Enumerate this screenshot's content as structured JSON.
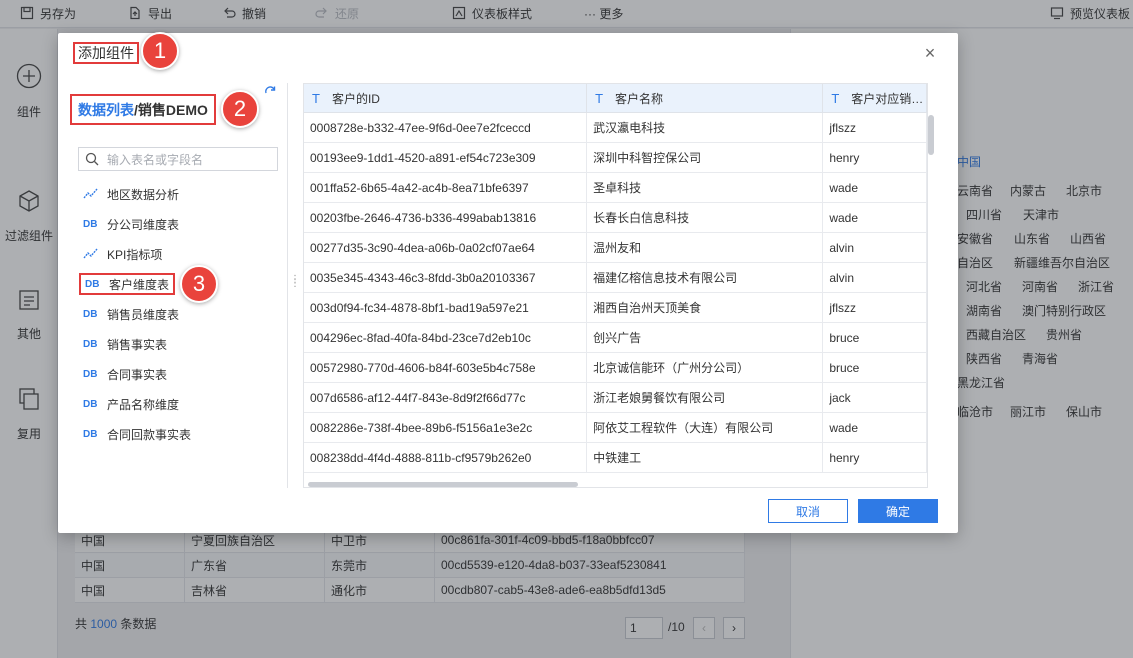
{
  "toolbar": {
    "save_as": "另存为",
    "export": "导出",
    "undo": "撤销",
    "redo": "还原",
    "dashboard_style": "仪表板样式",
    "more": "··· 更多",
    "preview": "预览仪表板"
  },
  "rail": {
    "components": "组件",
    "filter_components": "过滤组件",
    "others": "其他",
    "reuse": "复用"
  },
  "background": {
    "regions": {
      "china": "中国",
      "r1": [
        "云南省",
        "内蒙古",
        "北京市"
      ],
      "r2": [
        "四川省",
        "天津市"
      ],
      "r3": [
        "安徽省",
        "山东省",
        "山西省"
      ],
      "r4": [
        "自治区",
        "新疆维吾尔自治区"
      ],
      "r5": [
        "河北省",
        "河南省",
        "浙江省"
      ],
      "r6": [
        "湖南省",
        "澳门特别行政区"
      ],
      "r7": [
        "西藏自治区",
        "贵州省"
      ],
      "r8": [
        "陕西省",
        "青海省"
      ],
      "r9": [
        "黑龙江省"
      ],
      "r10": [
        "临沧市",
        "丽江市",
        "保山市"
      ]
    },
    "table_rows": [
      [
        "中国",
        "宁夏回族自治区",
        "中卫市",
        "00c861fa-301f-4c09-bbd5-f18a0bbfcc07"
      ],
      [
        "中国",
        "广东省",
        "东莞市",
        "00cd5539-e120-4da8-b037-33eaf5230841"
      ],
      [
        "中国",
        "吉林省",
        "通化市",
        "00cdb807-cab5-43e8-ade6-ea8b5dfd13d5"
      ]
    ],
    "footer_prefix": "共",
    "footer_count": "1000",
    "footer_suffix": "条数据",
    "page_current": "1",
    "page_total": "/10"
  },
  "dialog": {
    "title": "添加组件",
    "close": "×",
    "path_link": "数据列表",
    "path_current": "/销售DEMO",
    "search_placeholder": "输入表名或字段名",
    "tree": [
      {
        "icon": "kpi",
        "label": "地区数据分析"
      },
      {
        "icon": "db",
        "label": "分公司维度表"
      },
      {
        "icon": "kpi",
        "label": "KPI指标项"
      },
      {
        "icon": "db",
        "label": "客户维度表"
      },
      {
        "icon": "db",
        "label": "销售员维度表"
      },
      {
        "icon": "db",
        "label": "销售事实表"
      },
      {
        "icon": "db",
        "label": "合同事实表"
      },
      {
        "icon": "db",
        "label": "产品名称维度"
      },
      {
        "icon": "db",
        "label": "合同回款事实表"
      }
    ],
    "db_icon_text": "DB",
    "columns": [
      "客户的ID",
      "客户名称",
      "客户对应销…"
    ],
    "rows": [
      [
        "0008728e-b332-47ee-9f6d-0ee7e2fceccd",
        "武汉瀛电科技",
        "jflszz"
      ],
      [
        "00193ee9-1dd1-4520-a891-ef54c723e309",
        "深圳中科智控保公司",
        "henry"
      ],
      [
        "001ffa52-6b65-4a42-ac4b-8ea71bfe6397",
        "圣卓科技",
        "wade"
      ],
      [
        "00203fbe-2646-4736-b336-499abab13816",
        "长春长白信息科技",
        "wade"
      ],
      [
        "00277d35-3c90-4dea-a06b-0a02cf07ae64",
        "温州友和",
        "alvin"
      ],
      [
        "0035e345-4343-46c3-8fdd-3b0a20103367",
        "福建亿榕信息技术有限公司",
        "alvin"
      ],
      [
        "003d0f94-fc34-4878-8bf1-bad19a597e21",
        "湘西自治州天顶美食",
        "jflszz"
      ],
      [
        "004296ec-8fad-40fa-84bd-23ce7d2eb10c",
        "创兴广告",
        "bruce"
      ],
      [
        "00572980-770d-4606-b84f-603e5b4c758e",
        "北京诚信能环（广州分公司）",
        "bruce"
      ],
      [
        "007d6586-af12-44f7-843e-8d9f2f66d77c",
        "浙江老娘舅餐饮有限公司",
        "jack"
      ],
      [
        "0082286e-738f-4bee-89b6-f5156a1e3e2c",
        "阿依艾工程软件（大连）有限公司",
        "wade"
      ],
      [
        "008238dd-4f4d-4888-811b-cf9579b262e0",
        "中铁建工",
        "henry"
      ]
    ],
    "cancel": "取消",
    "confirm": "确定"
  },
  "badges": [
    "1",
    "2",
    "3"
  ],
  "colors": {
    "accent": "#2f7ae5",
    "highlight": "#e23b3b",
    "badge": "#e9433c"
  }
}
